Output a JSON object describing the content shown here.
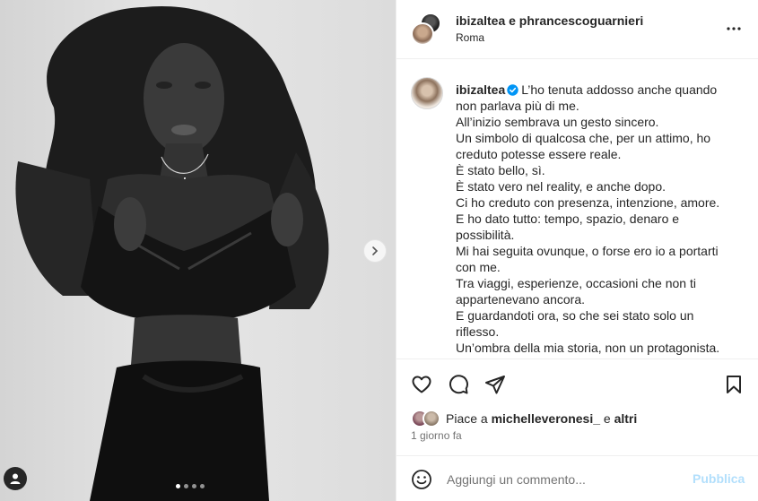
{
  "post": {
    "header": {
      "users_text": "ibizaltea e phrancescoguarnieri",
      "location": "Roma"
    },
    "caption": {
      "username": "ibizaltea",
      "lines": [
        "L’ho tenuta addosso anche quando",
        "non parlava più di me.",
        "All’inizio sembrava un gesto sincero.",
        "Un simbolo di qualcosa che, per un attimo, ho",
        "creduto potesse essere reale.",
        "È stato bello, sì.",
        "È stato vero nel reality, e anche dopo.",
        "Ci ho creduto con presenza, intenzione, amore.",
        "E ho dato tutto: tempo, spazio, denaro e",
        "possibilità.",
        "Mi hai seguita ovunque, o forse ero io a portarti",
        "con me.",
        "Tra viaggi, esperienze, occasioni che non ti",
        "appartenevano ancora.",
        "E guardandoti ora, so che sei stato solo un",
        "riflesso.",
        "Un’ombra della mia storia, non un protagonista."
      ]
    },
    "likes": {
      "prefix": "Piace a",
      "user": "michelleveronesi_",
      "conj": "e",
      "others": "altri"
    },
    "time": "1 giorno fa",
    "comment": {
      "placeholder": "Aggiungi un commento...",
      "publish_label": "Pubblica"
    },
    "carousel": {
      "dot_count": 4,
      "active_index": 0
    },
    "icons": {
      "like": "heart-icon",
      "comment": "comment-icon",
      "share": "paper-plane-icon",
      "save": "bookmark-icon",
      "more": "more-options-icon",
      "emoji": "emoji-icon",
      "next": "chevron-right-icon",
      "tag": "user-tag-icon",
      "verified": "verified-badge-icon"
    },
    "colors": {
      "text": "#262626",
      "secondary": "#737373",
      "publish_disabled": "#b2dffc",
      "verified": "#0095f6"
    }
  }
}
